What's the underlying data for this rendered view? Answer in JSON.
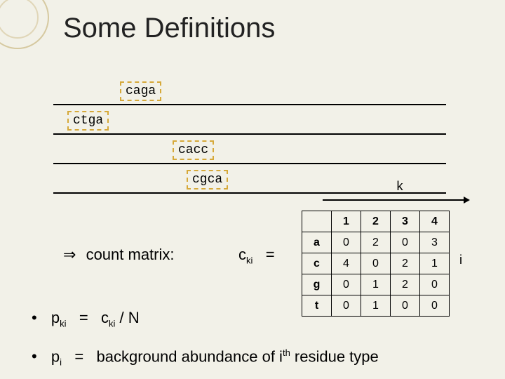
{
  "title": "Some Definitions",
  "sequences": {
    "s1": "caga",
    "s2": "ctga",
    "s3": "cacc",
    "s4": "cgca"
  },
  "axis": {
    "col_label": "k",
    "row_label": "i"
  },
  "matrix_label": {
    "implies": "⇒",
    "text": "count matrix:"
  },
  "cki": {
    "var": "c",
    "sub": "ki",
    "eq": "="
  },
  "table": {
    "cols": [
      "1",
      "2",
      "3",
      "4"
    ],
    "rows": [
      {
        "h": "a",
        "v": [
          "0",
          "2",
          "0",
          "3"
        ]
      },
      {
        "h": "c",
        "v": [
          "4",
          "0",
          "2",
          "1"
        ]
      },
      {
        "h": "g",
        "v": [
          "0",
          "1",
          "2",
          "0"
        ]
      },
      {
        "h": "t",
        "v": [
          "0",
          "1",
          "0",
          "0"
        ]
      }
    ]
  },
  "formula1": {
    "bullet": "•",
    "lhs_var": "p",
    "lhs_sub": "ki",
    "eq": "=",
    "rhs_var": "c",
    "rhs_sub": "ki",
    "over": "/ N"
  },
  "formula2": {
    "bullet": "•",
    "lhs_var": "p",
    "lhs_sub": "i",
    "eq": "=",
    "text1": "background abundance of i",
    "sup": "th",
    "text2": " residue type"
  },
  "chart_data": {
    "type": "table",
    "title": "Count matrix c_ki",
    "columns": [
      "1",
      "2",
      "3",
      "4"
    ],
    "rows": [
      "a",
      "c",
      "g",
      "t"
    ],
    "values": [
      [
        0,
        2,
        0,
        3
      ],
      [
        4,
        0,
        2,
        1
      ],
      [
        0,
        1,
        2,
        0
      ],
      [
        0,
        1,
        0,
        0
      ]
    ],
    "formulas": {
      "p_ki": "p_ki = c_ki / N",
      "p_i": "p_i = background abundance of i-th residue type"
    },
    "sequences": [
      "caga",
      "ctga",
      "cacc",
      "cgca"
    ]
  }
}
